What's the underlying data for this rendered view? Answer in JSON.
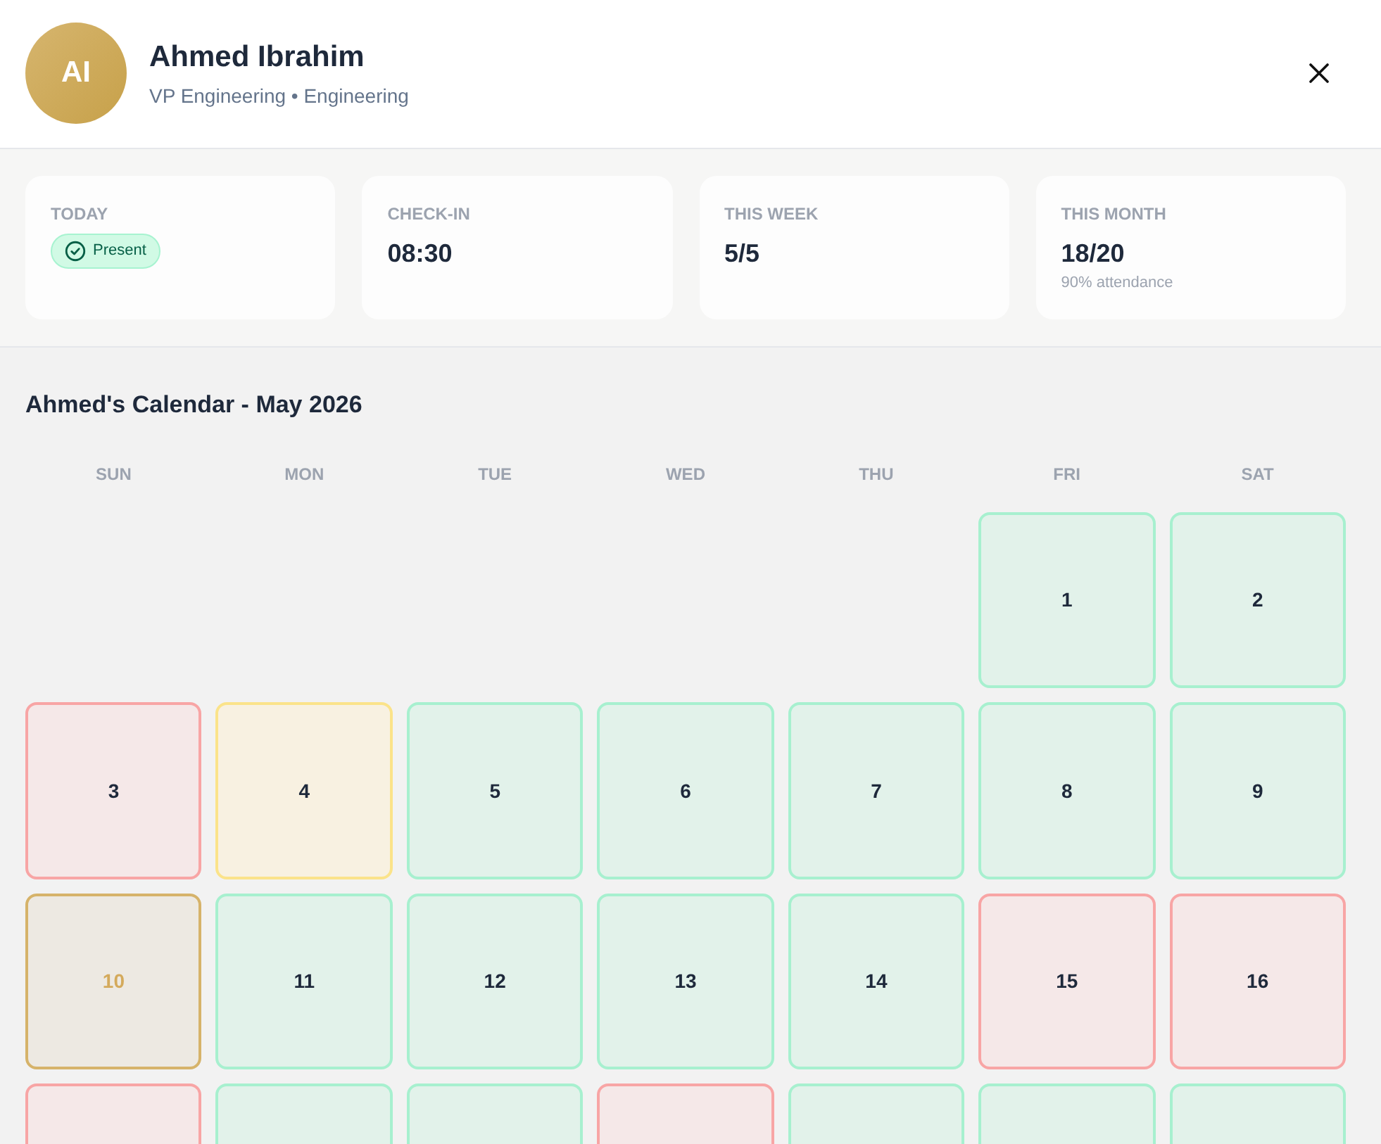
{
  "employee": {
    "initials": "AI",
    "name": "Ahmed Ibrahim",
    "subtitle": "VP Engineering • Engineering"
  },
  "stats": [
    {
      "kind": "badge",
      "label": "TODAY",
      "badge": "Present"
    },
    {
      "kind": "value",
      "label": "CHECK-IN",
      "value": "08:30"
    },
    {
      "kind": "value",
      "label": "THIS WEEK",
      "value": "5/5"
    },
    {
      "kind": "value",
      "label": "THIS MONTH",
      "value": "18/20",
      "note": "90% attendance"
    }
  ],
  "calendar": {
    "title": "Ahmed's Calendar - May 2026",
    "weekdays": [
      "SUN",
      "MON",
      "TUE",
      "WED",
      "THU",
      "FRI",
      "SAT"
    ],
    "weeks": [
      {
        "days": [
          {
            "kind": "empty"
          },
          {
            "kind": "empty"
          },
          {
            "kind": "empty"
          },
          {
            "kind": "empty"
          },
          {
            "kind": "empty"
          },
          {
            "kind": "present",
            "day": "1"
          },
          {
            "kind": "present",
            "day": "2"
          }
        ]
      },
      {
        "days": [
          {
            "kind": "absent",
            "day": "3"
          },
          {
            "kind": "late",
            "day": "4"
          },
          {
            "kind": "present",
            "day": "5"
          },
          {
            "kind": "present",
            "day": "6"
          },
          {
            "kind": "present",
            "day": "7"
          },
          {
            "kind": "present",
            "day": "8"
          },
          {
            "kind": "present",
            "day": "9"
          }
        ]
      },
      {
        "days": [
          {
            "kind": "today",
            "day": "10"
          },
          {
            "kind": "present",
            "day": "11"
          },
          {
            "kind": "present",
            "day": "12"
          },
          {
            "kind": "present",
            "day": "13"
          },
          {
            "kind": "present",
            "day": "14"
          },
          {
            "kind": "absent",
            "day": "15"
          },
          {
            "kind": "absent",
            "day": "16"
          }
        ]
      },
      {
        "days": [
          {
            "kind": "absent"
          },
          {
            "kind": "present"
          },
          {
            "kind": "present"
          },
          {
            "kind": "absent"
          },
          {
            "kind": "present"
          },
          {
            "kind": "present"
          },
          {
            "kind": "present"
          }
        ]
      }
    ]
  }
}
